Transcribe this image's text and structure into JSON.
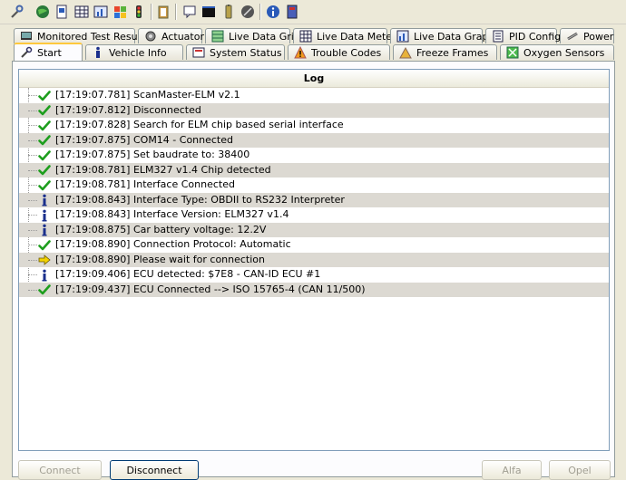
{
  "toolbar": {
    "buttons": [
      {
        "icon": "wrench-icon"
      },
      {
        "icon": "globe-icon"
      },
      {
        "icon": "document-icon"
      },
      {
        "icon": "grid-icon"
      },
      {
        "icon": "meter-icon"
      },
      {
        "icon": "windows-flag-icon"
      },
      {
        "icon": "traffic-light-icon"
      },
      {
        "icon": "clipboard-icon"
      },
      {
        "icon": "chat-icon"
      },
      {
        "icon": "terminal-icon"
      },
      {
        "icon": "battery-icon"
      },
      {
        "icon": "disc-icon"
      },
      {
        "icon": "info-icon"
      },
      {
        "icon": "book-icon"
      }
    ]
  },
  "tabs_top": [
    {
      "label": "Monitored Test Results",
      "icon": "monitor-icon"
    },
    {
      "label": "Actuator",
      "icon": "actuator-icon"
    },
    {
      "label": "Live Data Grid",
      "icon": "grid-icon"
    },
    {
      "label": "Live Data Meter",
      "icon": "meter-icon"
    },
    {
      "label": "Live Data Graph",
      "icon": "graph-icon"
    },
    {
      "label": "PID Config",
      "icon": "config-icon"
    },
    {
      "label": "Power",
      "icon": "power-icon"
    }
  ],
  "tabs_bottom": [
    {
      "label": "Start",
      "icon": "start-icon",
      "active": true
    },
    {
      "label": "Vehicle Info",
      "icon": "info-icon"
    },
    {
      "label": "System Status",
      "icon": "status-icon"
    },
    {
      "label": "Trouble Codes",
      "icon": "warning-icon"
    },
    {
      "label": "Freeze Frames",
      "icon": "freeze-icon"
    },
    {
      "label": "Oxygen Sensors",
      "icon": "sensor-icon"
    }
  ],
  "log": {
    "header": "Log",
    "entries": [
      {
        "type": "check",
        "text": "[17:19:07.781] ScanMaster-ELM v2.1"
      },
      {
        "type": "check",
        "text": "[17:19:07.812] Disconnected"
      },
      {
        "type": "check",
        "text": "[17:19:07.828] Search for ELM chip based serial interface"
      },
      {
        "type": "check",
        "text": "[17:19:07.875] COM14 - Connected"
      },
      {
        "type": "check",
        "text": "[17:19:07.875] Set baudrate to: 38400"
      },
      {
        "type": "check",
        "text": "[17:19:08.781] ELM327 v1.4 Chip detected"
      },
      {
        "type": "check",
        "text": "[17:19:08.781] Interface Connected"
      },
      {
        "type": "info",
        "text": "[17:19:08.843] Interface Type: OBDII to RS232 Interpreter"
      },
      {
        "type": "info",
        "text": "[17:19:08.843] Interface Version: ELM327 v1.4"
      },
      {
        "type": "info",
        "text": "[17:19:08.875] Car battery voltage: 12.2V"
      },
      {
        "type": "check",
        "text": "[17:19:08.890] Connection Protocol: Automatic"
      },
      {
        "type": "arrow",
        "text": "[17:19:08.890] Please wait for connection"
      },
      {
        "type": "info",
        "text": "[17:19:09.406] ECU detected: $7E8 - CAN-ID ECU #1"
      },
      {
        "type": "check",
        "text": "[17:19:09.437] ECU Connected --> ISO 15765-4 (CAN 11/500)"
      }
    ]
  },
  "buttons": {
    "connect": "Connect",
    "disconnect": "Disconnect",
    "alfa": "Alfa",
    "opel": "Opel"
  },
  "colors": {
    "check": "#1e9e1e",
    "info": "#1a2f8c",
    "arrow": "#f2d200",
    "active_tab_accent": "#ffc83c"
  }
}
